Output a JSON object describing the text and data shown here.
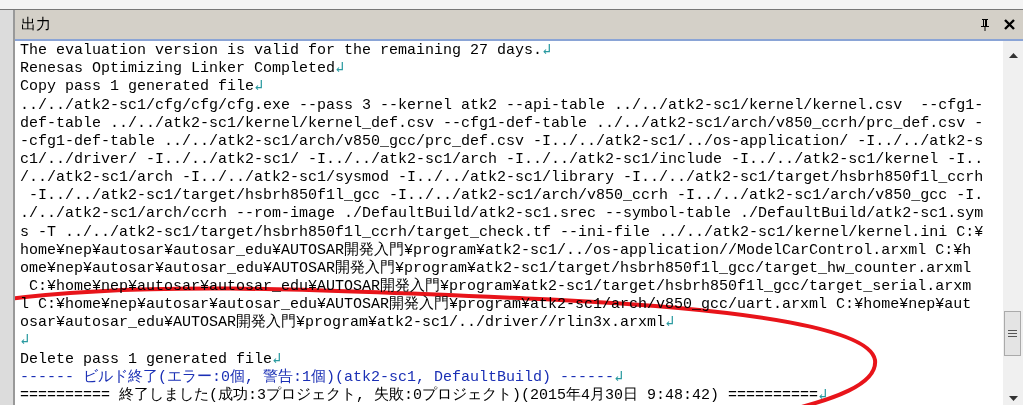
{
  "panel": {
    "title": "出力"
  },
  "lines": [
    {
      "text": "The evaluation version is valid for the remaining 27 days.",
      "kind": "normal",
      "end": "↲"
    },
    {
      "text": "Renesas Optimizing Linker Completed",
      "kind": "normal",
      "end": "↲"
    },
    {
      "text": "Copy pass 1 generated file",
      "kind": "normal",
      "end": "↲"
    },
    {
      "text": "../../atk2-sc1/cfg/cfg/cfg.exe --pass 3 --kernel atk2 --api-table ../../atk2-sc1/kernel/kernel.csv  --cfg1-",
      "kind": "normal"
    },
    {
      "text": "def-table ../../atk2-sc1/kernel/kernel_def.csv --cfg1-def-table ../../atk2-sc1/arch/v850_ccrh/prc_def.csv -",
      "kind": "normal"
    },
    {
      "text": "-cfg1-def-table ../../atk2-sc1/arch/v850_gcc/prc_def.csv -I../../atk2-sc1/../os-application/ -I../../atk2-s",
      "kind": "normal"
    },
    {
      "text": "c1/../driver/ -I../../atk2-sc1/ -I../../atk2-sc1/arch -I../../atk2-sc1/include -I../../atk2-sc1/kernel -I..",
      "kind": "normal"
    },
    {
      "text": "/../atk2-sc1/arch -I../../atk2-sc1/sysmod -I../../atk2-sc1/library -I../../atk2-sc1/target/hsbrh850f1l_ccrh",
      "kind": "normal"
    },
    {
      "text": " -I../../atk2-sc1/target/hsbrh850f1l_gcc -I../../atk2-sc1/arch/v850_ccrh -I../../atk2-sc1/arch/v850_gcc -I.",
      "kind": "normal"
    },
    {
      "text": "./../atk2-sc1/arch/ccrh --rom-image ./DefaultBuild/atk2-sc1.srec --symbol-table ./DefaultBuild/atk2-sc1.sym",
      "kind": "normal"
    },
    {
      "text": "s -T ../../atk2-sc1/target/hsbrh850f1l_ccrh/target_check.tf --ini-file ../../atk2-sc1/kernel/kernel.ini C:¥",
      "kind": "normal"
    },
    {
      "text": "home¥nep¥autosar¥autosar_edu¥AUTOSAR開発入門¥program¥atk2-sc1/../os-application//ModelCarControl.arxml C:¥h",
      "kind": "normal"
    },
    {
      "text": "ome¥nep¥autosar¥autosar_edu¥AUTOSAR開発入門¥program¥atk2-sc1/target/hsbrh850f1l_gcc/target_hw_counter.arxml",
      "kind": "normal"
    },
    {
      "text": " C:¥home¥nep¥autosar¥autosar_edu¥AUTOSAR開発入門¥program¥atk2-sc1/target/hsbrh850f1l_gcc/target_serial.arxm",
      "kind": "normal"
    },
    {
      "text": "l C:¥home¥nep¥autosar¥autosar_edu¥AUTOSAR開発入門¥program¥atk2-sc1/arch/v850_gcc/uart.arxml C:¥home¥nep¥aut",
      "kind": "normal"
    },
    {
      "text": "osar¥autosar_edu¥AUTOSAR開発入門¥program¥atk2-sc1/../driver//rlin3x.arxml",
      "kind": "normal",
      "end": "↲"
    },
    {
      "kind": "normal",
      "end": "↲"
    },
    {
      "text": "Delete pass 1 generated file",
      "kind": "normal",
      "end": "↲"
    },
    {
      "text": "------ ビルド終了(エラー:0個, 警告:1個)(atk2-sc1, DefaultBuild) ------",
      "kind": "build",
      "end": "↲"
    },
    {
      "text": "========== 終了しました(成功:3プロジェクト, 失敗:0プロジェクト)(2015年4月30日 9:48:42) ==========",
      "kind": "normal",
      "end": "↲"
    }
  ]
}
